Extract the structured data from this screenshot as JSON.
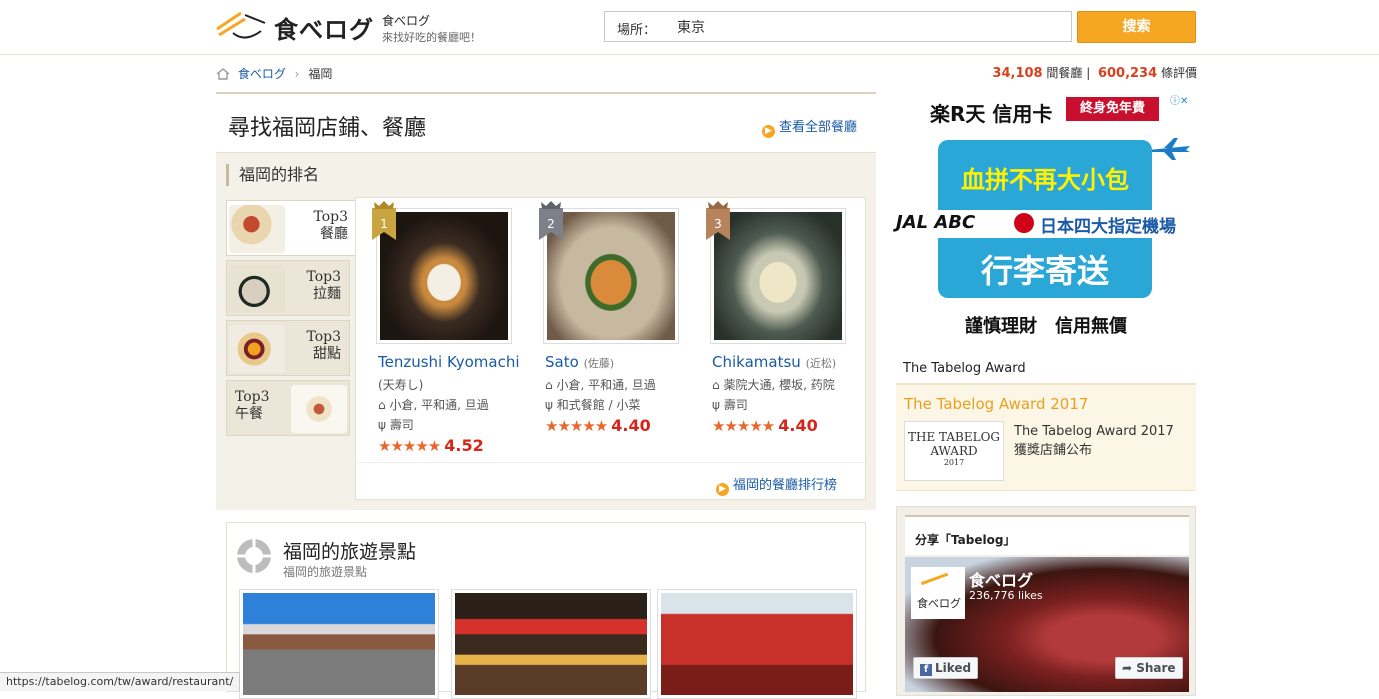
{
  "header": {
    "logo_text": "食べログ",
    "logo_sub_title": "食べログ",
    "logo_tagline": "來找好吃的餐廳吧！",
    "search_label": "場所：",
    "search_value": "東京",
    "search_button": "搜索"
  },
  "breadcrumb": {
    "home": "食べログ",
    "separator": "›",
    "current": "福岡"
  },
  "stats": {
    "restaurants_count": "34,108",
    "restaurants_label": "間餐廳",
    "reviews_count": "600,234",
    "reviews_label": "條評價"
  },
  "main": {
    "title": "尋找福岡店鋪、餐廳",
    "view_all": "查看全部餐廳",
    "ranking_title": "福岡的排名",
    "tabs": [
      {
        "label_top": "Top3",
        "label_bottom": "餐廳"
      },
      {
        "label_top": "Top3",
        "label_bottom": "拉麵"
      },
      {
        "label_top": "Top3",
        "label_bottom": "甜點"
      },
      {
        "label_top": "Top3",
        "label_bottom": "午餐"
      }
    ],
    "cards": [
      {
        "rank": "1",
        "name": "Tenzushi Kyomachi",
        "name_jp": "(天寿し)",
        "area": "小倉, 平和通, 旦過",
        "genre": "壽司",
        "stars": "★★★★★",
        "score": "4.52",
        "rating": 4.52
      },
      {
        "rank": "2",
        "name": "Sato",
        "name_jp": "(佐藤)",
        "area": "小倉, 平和通, 旦過",
        "genre": "和式餐館 / 小菜",
        "stars": "★★★★★",
        "score": "4.40",
        "rating": 4.4
      },
      {
        "rank": "3",
        "name": "Chikamatsu",
        "name_jp": "(近松)",
        "area": "薬院大通, 櫻坂, 药院",
        "genre": "壽司",
        "stars": "★★★★★",
        "score": "4.40",
        "rating": 4.4
      }
    ],
    "ranking_link": "福岡的餐廳排行榜"
  },
  "travel": {
    "title": "福岡的旅遊景點",
    "subtitle": "福岡的旅遊景點"
  },
  "ad": {
    "brand": "楽R天 信用卡",
    "badge": "終身免年費",
    "headline": "血拼不再大小包",
    "jal": "JAL ABC",
    "airports": "日本四大指定機場",
    "service": "行李寄送",
    "slogan": "謹慎理財　信用無價"
  },
  "award": {
    "heading": "The Tabelog Award",
    "title": "The Tabelog Award 2017",
    "logo_line1": "THE TABELOG",
    "logo_line2": "AWARD",
    "logo_year": "2017",
    "text_line1": "The Tabelog Award 2017",
    "text_line2": "獲獎店鋪公布"
  },
  "facebook": {
    "heading": "分享「Tabelog」",
    "page_name": "食べログ",
    "likes": "236,776 likes",
    "like_button": "Liked",
    "share_button": "Share",
    "logo_text": "食べログ"
  },
  "status_bar": "https://tabelog.com/tw/award/restaurant/",
  "colors": {
    "accent": "#f5a623",
    "link": "#1a5aa6",
    "score": "#d9241a",
    "stars": "#e8672c"
  }
}
